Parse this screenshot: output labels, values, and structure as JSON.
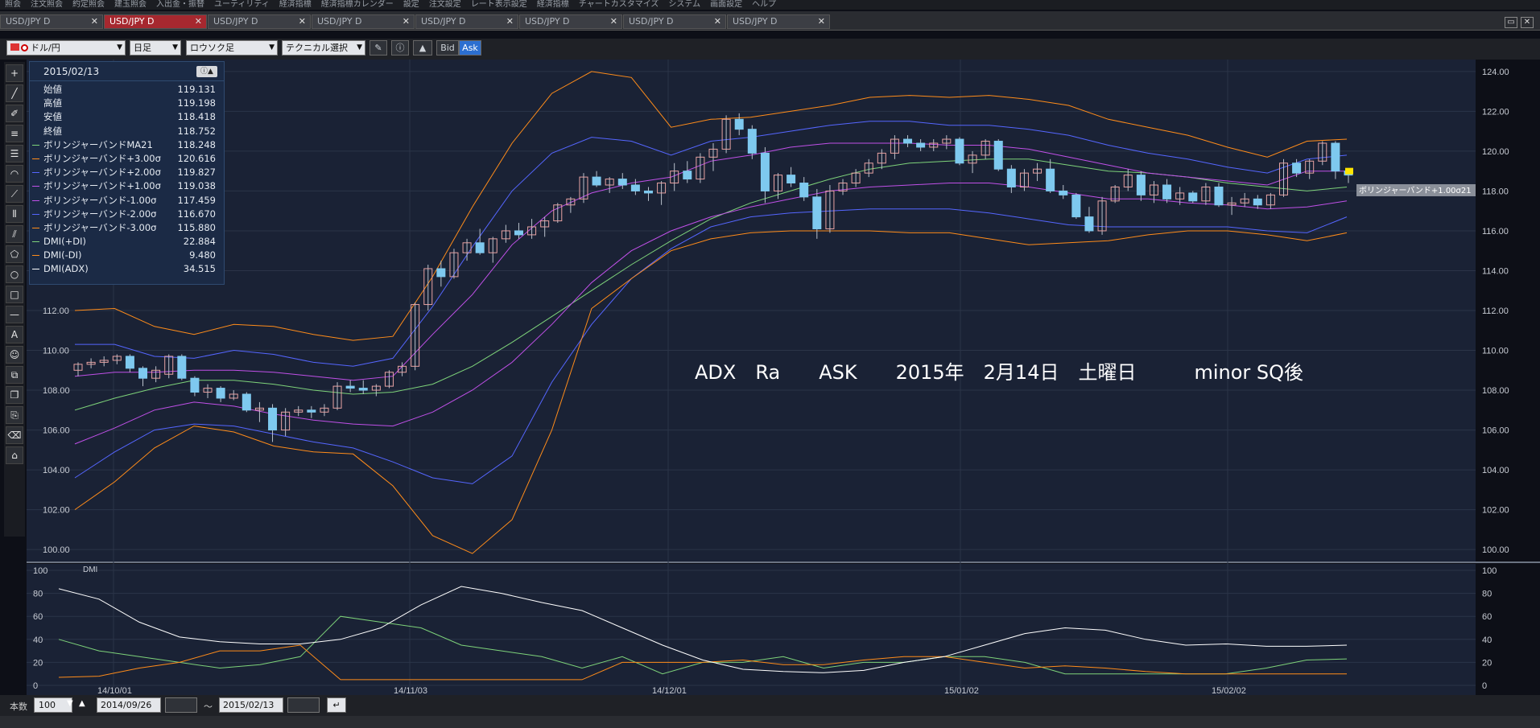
{
  "menu": {
    "items": [
      "照会",
      "注文照会",
      "約定照会",
      "建玉照会",
      "入出金・振替",
      "ユーティリティ",
      "経済指標",
      "経済指標カレンダー",
      "設定",
      "注文設定",
      "レート表示設定",
      "経済指標",
      "チャートカスタマイズ",
      "システム",
      "画面設定",
      "ヘルプ"
    ]
  },
  "tabs": [
    {
      "label": "USD/JPY D",
      "active": false
    },
    {
      "label": "USD/JPY D",
      "active": true
    },
    {
      "label": "USD/JPY D",
      "active": false
    },
    {
      "label": "USD/JPY D",
      "active": false
    },
    {
      "label": "USD/JPY D",
      "active": false
    },
    {
      "label": "USD/JPY D",
      "active": false
    },
    {
      "label": "USD/JPY D",
      "active": false
    },
    {
      "label": "USD/JPY D",
      "active": false
    }
  ],
  "toolbar": {
    "symbol": "ドル/円",
    "period": "日足",
    "chart_type": "ロウソク足",
    "technical": "テクニカル選択",
    "bid": "Bid",
    "ask": "Ask"
  },
  "info": {
    "date": "2015/02/13",
    "rows": [
      {
        "label": "始値",
        "value": "119.131",
        "color": ""
      },
      {
        "label": "高値",
        "value": "119.198",
        "color": ""
      },
      {
        "label": "安値",
        "value": "118.418",
        "color": ""
      },
      {
        "label": "終値",
        "value": "118.752",
        "color": ""
      },
      {
        "label": "ボリンジャーバンドMA21",
        "value": "118.248",
        "color": "#7ed37a"
      },
      {
        "label": "ボリンジャーバンド+3.00σ",
        "value": "120.616",
        "color": "#ff8c1a"
      },
      {
        "label": "ボリンジャーバンド+2.00σ",
        "value": "119.827",
        "color": "#5566ff"
      },
      {
        "label": "ボリンジャーバンド+1.00σ",
        "value": "119.038",
        "color": "#c050e8"
      },
      {
        "label": "ボリンジャーバンド-1.00σ",
        "value": "117.459",
        "color": "#c050e8"
      },
      {
        "label": "ボリンジャーバンド-2.00σ",
        "value": "116.670",
        "color": "#5566ff"
      },
      {
        "label": "ボリンジャーバンド-3.00σ",
        "value": "115.880",
        "color": "#ff8c1a"
      },
      {
        "label": "DMI(+DI)",
        "value": "22.884",
        "color": "#7ed37a"
      },
      {
        "label": "DMI(-DI)",
        "value": "9.480",
        "color": "#ff8c1a"
      },
      {
        "label": "DMI(ADX)",
        "value": "34.515",
        "color": "#ffffff"
      }
    ]
  },
  "annotation": "ADX　Ra　　ASK　　2015年　2月14日　土曜日　　　minor SQ後",
  "price_tag": "ボリンジャーバンド+1.00σ21",
  "dmi_label": "DMI",
  "bottom": {
    "count_label": "本数",
    "count_value": "100",
    "start_date": "2014/09/26",
    "tilde": "～",
    "end_date": "2015/02/13"
  },
  "colors": {
    "up": "#e8a3a3",
    "down": "#7ec9ef",
    "bg": "#1a2235"
  },
  "chart_data": {
    "type": "line",
    "x": [
      "14/10/01",
      "14/11/03",
      "14/12/01",
      "15/01/02",
      "15/02/02"
    ],
    "y_ticks_price": [
      "124.00",
      "122.00",
      "120.00",
      "118.00",
      "116.00",
      "114.00",
      "112.00",
      "110.00",
      "108.00",
      "106.00",
      "104.00",
      "102.00",
      "100.00"
    ],
    "y_ticks_dmi": [
      "100",
      "80",
      "60",
      "40",
      "20",
      "0"
    ],
    "ylim_price": [
      99.4,
      124.6
    ],
    "ylim_dmi": [
      0,
      100
    ],
    "candles": [
      [
        109.0,
        109.4,
        108.7,
        109.3
      ],
      [
        109.3,
        109.6,
        109.1,
        109.4
      ],
      [
        109.4,
        109.7,
        109.2,
        109.5
      ],
      [
        109.5,
        109.8,
        109.3,
        109.7
      ],
      [
        109.7,
        109.8,
        108.9,
        109.1
      ],
      [
        109.1,
        109.2,
        108.2,
        108.6
      ],
      [
        108.6,
        109.2,
        108.4,
        109.0
      ],
      [
        108.8,
        109.8,
        108.6,
        109.7
      ],
      [
        109.7,
        109.8,
        108.5,
        108.6
      ],
      [
        108.6,
        108.7,
        107.7,
        107.9
      ],
      [
        107.9,
        108.3,
        107.6,
        108.1
      ],
      [
        108.1,
        108.2,
        107.4,
        107.6
      ],
      [
        107.6,
        108.0,
        107.5,
        107.8
      ],
      [
        107.8,
        107.9,
        106.9,
        107.0
      ],
      [
        107.0,
        107.4,
        106.4,
        107.1
      ],
      [
        107.1,
        107.3,
        105.4,
        106.0
      ],
      [
        106.0,
        107.1,
        105.7,
        106.9
      ],
      [
        106.9,
        107.2,
        106.7,
        107.0
      ],
      [
        107.0,
        107.2,
        106.6,
        106.9
      ],
      [
        106.9,
        107.3,
        106.7,
        107.1
      ],
      [
        107.1,
        108.4,
        107.0,
        108.2
      ],
      [
        108.2,
        108.5,
        107.9,
        108.1
      ],
      [
        108.1,
        108.5,
        107.8,
        108.0
      ],
      [
        108.0,
        108.3,
        107.7,
        108.2
      ],
      [
        108.2,
        109.0,
        108.1,
        108.9
      ],
      [
        108.9,
        109.4,
        108.7,
        109.2
      ],
      [
        109.2,
        112.4,
        109.0,
        112.3
      ],
      [
        112.3,
        114.3,
        112.0,
        114.1
      ],
      [
        114.1,
        114.5,
        113.2,
        113.7
      ],
      [
        113.7,
        115.1,
        113.6,
        114.9
      ],
      [
        114.9,
        115.6,
        114.5,
        115.4
      ],
      [
        115.4,
        116.1,
        114.8,
        114.9
      ],
      [
        114.9,
        115.7,
        114.4,
        115.6
      ],
      [
        115.6,
        116.3,
        115.4,
        116.0
      ],
      [
        116.0,
        116.4,
        115.6,
        115.8
      ],
      [
        115.8,
        116.6,
        115.6,
        116.2
      ],
      [
        116.2,
        116.7,
        115.7,
        116.5
      ],
      [
        116.5,
        117.4,
        116.4,
        117.3
      ],
      [
        117.3,
        117.7,
        116.9,
        117.6
      ],
      [
        117.6,
        118.9,
        117.4,
        118.7
      ],
      [
        118.7,
        119.0,
        118.2,
        118.3
      ],
      [
        118.3,
        118.7,
        117.9,
        118.6
      ],
      [
        118.6,
        118.9,
        118.1,
        118.3
      ],
      [
        118.3,
        118.6,
        117.8,
        118.0
      ],
      [
        118.0,
        118.2,
        117.5,
        117.9
      ],
      [
        117.9,
        118.5,
        117.3,
        118.4
      ],
      [
        118.4,
        119.4,
        118.0,
        119.0
      ],
      [
        119.0,
        119.5,
        118.4,
        118.6
      ],
      [
        118.6,
        119.9,
        118.4,
        119.7
      ],
      [
        119.7,
        120.4,
        119.0,
        120.1
      ],
      [
        120.1,
        121.8,
        119.9,
        121.6
      ],
      [
        121.6,
        121.9,
        120.8,
        121.1
      ],
      [
        121.1,
        121.3,
        119.6,
        119.9
      ],
      [
        119.9,
        120.2,
        117.4,
        118.0
      ],
      [
        118.0,
        118.9,
        117.6,
        118.8
      ],
      [
        118.8,
        119.2,
        118.2,
        118.4
      ],
      [
        118.4,
        118.7,
        117.5,
        117.7
      ],
      [
        117.7,
        118.1,
        115.6,
        116.1
      ],
      [
        116.1,
        118.3,
        115.9,
        118.0
      ],
      [
        118.0,
        118.6,
        117.8,
        118.4
      ],
      [
        118.4,
        119.1,
        118.2,
        118.9
      ],
      [
        118.9,
        119.6,
        118.7,
        119.4
      ],
      [
        119.4,
        120.1,
        119.1,
        119.9
      ],
      [
        119.9,
        120.8,
        119.6,
        120.6
      ],
      [
        120.6,
        120.8,
        120.2,
        120.4
      ],
      [
        120.4,
        120.6,
        120.0,
        120.2
      ],
      [
        120.2,
        120.6,
        120.0,
        120.4
      ],
      [
        120.4,
        120.8,
        120.1,
        120.6
      ],
      [
        120.6,
        120.7,
        119.3,
        119.4
      ],
      [
        119.4,
        120.0,
        118.9,
        119.8
      ],
      [
        119.8,
        120.6,
        119.6,
        120.5
      ],
      [
        120.5,
        120.6,
        119.0,
        119.1
      ],
      [
        119.1,
        119.3,
        117.9,
        118.2
      ],
      [
        118.2,
        119.1,
        118.0,
        118.9
      ],
      [
        118.9,
        119.4,
        118.5,
        119.1
      ],
      [
        119.1,
        119.6,
        117.9,
        118.0
      ],
      [
        118.0,
        118.3,
        117.6,
        117.8
      ],
      [
        117.8,
        117.9,
        116.6,
        116.7
      ],
      [
        116.7,
        117.2,
        115.9,
        116.0
      ],
      [
        116.0,
        117.7,
        115.8,
        117.5
      ],
      [
        117.5,
        118.3,
        117.4,
        118.2
      ],
      [
        118.2,
        119.1,
        118.0,
        118.8
      ],
      [
        118.8,
        119.0,
        117.5,
        117.8
      ],
      [
        117.8,
        118.5,
        117.4,
        118.3
      ],
      [
        118.3,
        118.6,
        117.4,
        117.6
      ],
      [
        117.6,
        118.2,
        117.3,
        117.9
      ],
      [
        117.9,
        118.0,
        117.4,
        117.5
      ],
      [
        117.5,
        118.4,
        117.3,
        118.2
      ],
      [
        118.2,
        118.4,
        117.2,
        117.3
      ],
      [
        117.3,
        117.7,
        116.8,
        117.4
      ],
      [
        117.4,
        117.9,
        117.2,
        117.6
      ],
      [
        117.6,
        117.8,
        117.1,
        117.3
      ],
      [
        117.3,
        117.9,
        117.1,
        117.8
      ],
      [
        117.8,
        119.6,
        117.7,
        119.4
      ],
      [
        119.4,
        119.6,
        118.7,
        118.9
      ],
      [
        118.9,
        119.6,
        118.6,
        119.5
      ],
      [
        119.5,
        120.5,
        119.3,
        120.4
      ],
      [
        120.4,
        120.5,
        118.6,
        119.0
      ],
      [
        119.0,
        119.1,
        118.4,
        118.8
      ]
    ],
    "series": [
      {
        "name": "ボリンジャーバンドMA21",
        "color": "#7ed37a",
        "values": [
          107.0,
          107.6,
          108.1,
          108.5,
          108.5,
          108.3,
          108.0,
          107.8,
          107.9,
          108.3,
          109.2,
          110.4,
          111.7,
          113.0,
          114.3,
          115.5,
          116.6,
          117.4,
          118.0,
          118.6,
          119.1,
          119.4,
          119.5,
          119.6,
          119.6,
          119.3,
          119.0,
          118.9,
          118.7,
          118.4,
          118.2,
          118.0,
          118.2
        ]
      },
      {
        "name": "ボリンジャーバンド+3.00σ",
        "color": "#ff8c1a",
        "values": [
          112.0,
          112.1,
          111.2,
          110.8,
          111.3,
          111.2,
          110.8,
          110.5,
          110.7,
          113.7,
          117.2,
          120.4,
          122.9,
          124.0,
          123.7,
          121.2,
          121.6,
          121.7,
          122.0,
          122.3,
          122.7,
          122.8,
          122.7,
          122.8,
          122.6,
          122.3,
          121.6,
          121.2,
          120.8,
          120.2,
          119.7,
          120.5,
          120.6
        ]
      },
      {
        "name": "ボリンジャーバンド+2.00σ",
        "color": "#5566ff",
        "values": [
          110.3,
          110.3,
          109.7,
          109.6,
          110.0,
          109.8,
          109.4,
          109.2,
          109.6,
          112.2,
          115.2,
          118.0,
          119.9,
          120.7,
          120.5,
          119.8,
          120.5,
          120.7,
          121.0,
          121.3,
          121.5,
          121.5,
          121.3,
          121.3,
          121.1,
          120.8,
          120.3,
          119.9,
          119.6,
          119.2,
          118.9,
          119.6,
          119.8
        ]
      },
      {
        "name": "ボリンジャーバンド+1.00σ",
        "color": "#c050e8",
        "values": [
          108.7,
          108.9,
          108.9,
          109.0,
          109.0,
          108.9,
          108.7,
          108.5,
          108.7,
          110.8,
          112.8,
          115.3,
          117.0,
          117.9,
          118.4,
          118.7,
          119.5,
          119.8,
          120.2,
          120.4,
          120.4,
          120.4,
          120.3,
          120.3,
          120.1,
          119.7,
          119.3,
          118.9,
          118.7,
          118.5,
          118.3,
          119.0,
          119.0
        ]
      },
      {
        "name": "ボリンジャーバンド-1.00σ",
        "color": "#c050e8",
        "values": [
          105.3,
          106.1,
          107.0,
          107.4,
          107.2,
          106.8,
          106.5,
          106.3,
          106.2,
          106.9,
          108.0,
          109.4,
          111.3,
          113.4,
          115.0,
          116.0,
          116.7,
          117.2,
          117.6,
          118.0,
          118.2,
          118.3,
          118.4,
          118.4,
          118.2,
          117.9,
          117.6,
          117.6,
          117.4,
          117.3,
          117.1,
          117.2,
          117.5
        ]
      },
      {
        "name": "ボリンジャーバンド-2.00σ",
        "color": "#5566ff",
        "values": [
          103.6,
          104.9,
          106.0,
          106.3,
          106.2,
          105.8,
          105.4,
          105.1,
          104.4,
          103.6,
          103.3,
          104.7,
          108.4,
          111.3,
          113.6,
          115.1,
          116.2,
          116.7,
          116.9,
          117.0,
          117.1,
          117.1,
          117.1,
          116.9,
          116.6,
          116.3,
          116.2,
          116.2,
          116.2,
          116.2,
          116.0,
          115.9,
          116.7
        ]
      },
      {
        "name": "ボリンジャーバンド-3.00σ",
        "color": "#ff8c1a",
        "values": [
          102.0,
          103.4,
          105.1,
          106.2,
          105.9,
          105.2,
          104.9,
          104.8,
          103.2,
          100.7,
          99.8,
          101.5,
          106.0,
          112.1,
          113.6,
          115.0,
          115.6,
          115.9,
          116.0,
          116.0,
          116.0,
          115.9,
          115.9,
          115.6,
          115.3,
          115.4,
          115.5,
          115.8,
          116.0,
          116.0,
          115.8,
          115.5,
          115.9
        ]
      }
    ],
    "dmi": [
      {
        "name": "DMI(+DI)",
        "color": "#7ed37a",
        "values": [
          40,
          30,
          25,
          20,
          15,
          18,
          25,
          60,
          55,
          50,
          35,
          30,
          25,
          15,
          25,
          10,
          20,
          20,
          25,
          15,
          20,
          20,
          25,
          25,
          20,
          10,
          10,
          10,
          10,
          10,
          15,
          22,
          23
        ]
      },
      {
        "name": "DMI(-DI)",
        "color": "#ff8c1a",
        "values": [
          7,
          8,
          15,
          20,
          30,
          30,
          35,
          5,
          5,
          5,
          5,
          5,
          5,
          5,
          20,
          20,
          20,
          22,
          18,
          18,
          22,
          25,
          25,
          20,
          15,
          17,
          15,
          12,
          10,
          10,
          10,
          10,
          10
        ]
      },
      {
        "name": "DMI(ADX)",
        "color": "#ffffff",
        "values": [
          84,
          75,
          55,
          42,
          38,
          36,
          36,
          40,
          50,
          70,
          86,
          80,
          72,
          65,
          50,
          35,
          22,
          14,
          12,
          11,
          13,
          20,
          25,
          35,
          45,
          50,
          48,
          40,
          35,
          36,
          34,
          34,
          35
        ]
      }
    ]
  }
}
